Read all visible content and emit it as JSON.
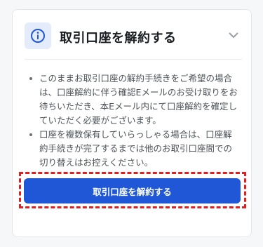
{
  "panel": {
    "title": "取引口座を解約する",
    "icons": {
      "info": "info-circle-icon",
      "toggle": "chevron-down-icon"
    }
  },
  "notes": [
    "このままお取引口座の解約手続きをご希望の場合は、口座解約に伴う確認Eメールのお受け取りをお待ちいただき、本Eメール内にて口座解約を確定していただく必要がございます。",
    "口座を複数保有していらっしゃる場合は、口座解約手続きが完了するまでは他のお取引口座間での切り替えはお控えください。"
  ],
  "action": {
    "button_label": "取引口座を解約する"
  },
  "colors": {
    "accent": "#1f57d6",
    "highlight_border": "#e02020",
    "icon_bg": "#e4ecfb"
  }
}
